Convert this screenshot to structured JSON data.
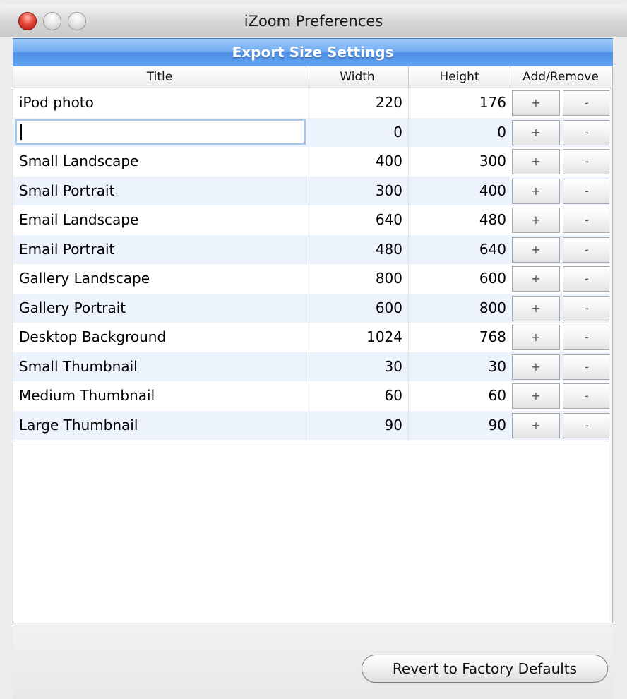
{
  "window": {
    "title": "iZoom Preferences"
  },
  "section": {
    "header": "Export Size Settings"
  },
  "table": {
    "columns": {
      "title": "Title",
      "width": "Width",
      "height": "Height",
      "add_remove": "Add/Remove"
    },
    "add_label": "+",
    "remove_label": "-",
    "rows": [
      {
        "title": "iPod photo",
        "width": "220",
        "height": "176"
      },
      {
        "title": "",
        "width": "0",
        "height": "0"
      },
      {
        "title": "Small Landscape",
        "width": "400",
        "height": "300"
      },
      {
        "title": "Small Portrait",
        "width": "300",
        "height": "400"
      },
      {
        "title": "Email Landscape",
        "width": "640",
        "height": "480"
      },
      {
        "title": "Email Portrait",
        "width": "480",
        "height": "640"
      },
      {
        "title": "Gallery Landscape",
        "width": "800",
        "height": "600"
      },
      {
        "title": "Gallery Portrait",
        "width": "600",
        "height": "800"
      },
      {
        "title": "Desktop Background",
        "width": "1024",
        "height": "768"
      },
      {
        "title": "Small Thumbnail",
        "width": "30",
        "height": "30"
      },
      {
        "title": "Medium Thumbnail",
        "width": "60",
        "height": "60"
      },
      {
        "title": "Large Thumbnail",
        "width": "90",
        "height": "90"
      }
    ]
  },
  "footer": {
    "revert_label": "Revert to Factory Defaults"
  }
}
